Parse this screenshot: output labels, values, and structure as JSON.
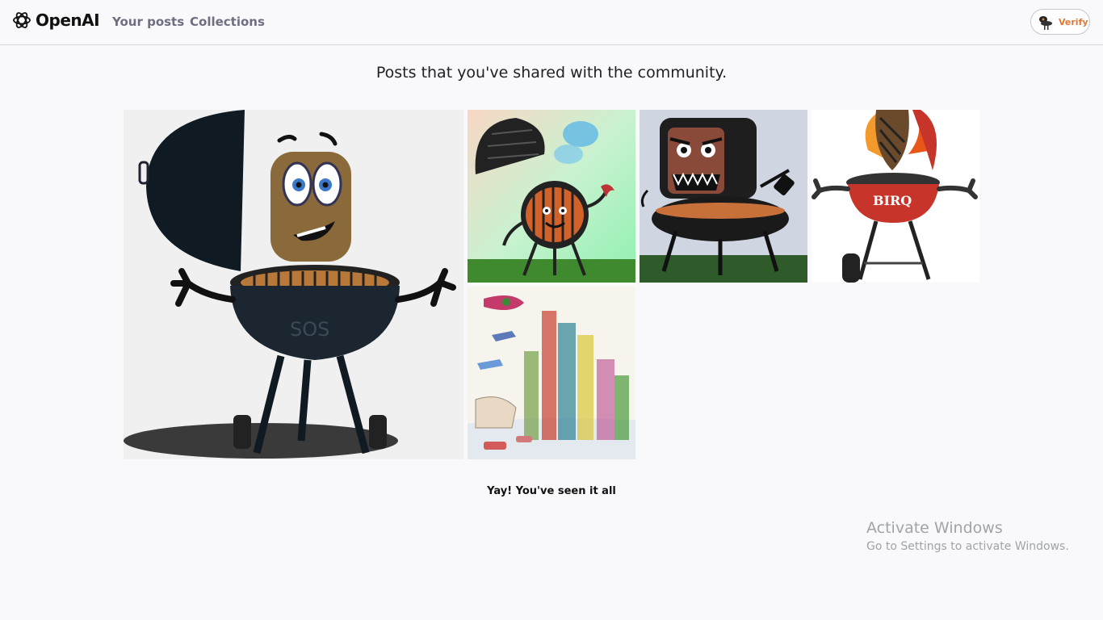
{
  "header": {
    "brand": "OpenAI",
    "nav": [
      "Your posts",
      "Collections"
    ],
    "verify_label": "Verify"
  },
  "main": {
    "title": "Posts that you've shared with the community.",
    "end_message": "Yay! You've seen it all"
  },
  "posts": [
    {
      "subject": "cartoon bbq grill character with face on lid",
      "grill_text": "SOS"
    },
    {
      "subject": "cartoon grill with smoke and crab claw arms"
    },
    {
      "subject": "angry grill with sharp teeth and spatula"
    },
    {
      "subject": "flaming grill character",
      "grill_text": "BIRQ"
    },
    {
      "subject": "watercolor city with towers and flying ships"
    }
  ],
  "watermark": {
    "title": "Activate Windows",
    "subtitle": "Go to Settings to activate Windows."
  },
  "colors": {
    "accent": "#e07a3a",
    "nav_text": "#6e6e80",
    "background": "#f9f9fb"
  }
}
